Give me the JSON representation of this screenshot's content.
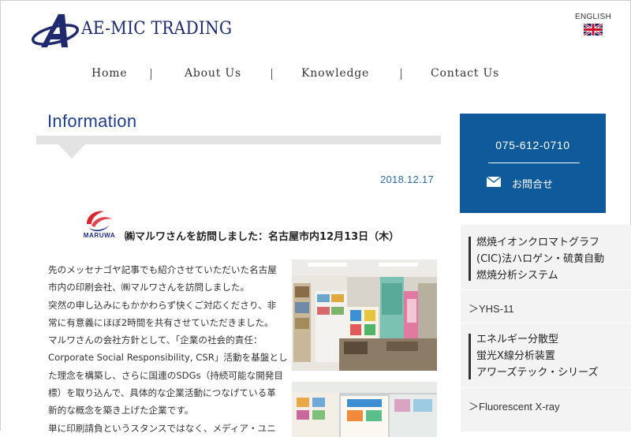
{
  "header": {
    "brand": "AE-MIC TRADING",
    "language_label": "ENGLISH"
  },
  "nav": {
    "items": [
      "Home",
      "About Us",
      "Knowledge",
      "Contact Us"
    ]
  },
  "main": {
    "section_title": "Information",
    "date": "2018.12.17",
    "company_logo_text": "MARUWA",
    "post_title": "㈱マルワさんを訪問しました：名古屋市内12月13日（木）",
    "body_lines": [
      "先のメッセナゴヤ記事でも紹介させていただいた名古屋",
      "市内の印刷会社、㈱マルワさんを訪問しました。",
      "突然の申し込みにもかかわらず快くご対応くださり、非",
      "常に有意義にほぼ2時間を共有させていただきました。",
      "マルワさんの会社方針として、「企業の社会的責任：",
      "Corporate Social Responsibility, CSR」活動を基盤とし",
      "た理念を構築し、さらに国連のSDGs（持続可能な開発目",
      "標）を取り込んで、具体的な企業活動につなげている革",
      "新的な概念を築き上げた企業です。",
      "単に印刷請負というスタンスではなく、メディア・ユニ"
    ]
  },
  "sidebar": {
    "phone": "075-612-0710",
    "contact_label": "お問合せ",
    "products": [
      {
        "title_lines": [
          "燃焼イオンクロマトグラフ",
          "(CIC)法ハロゲン・硫黄自動",
          "燃焼分析システム"
        ],
        "link": "＞YHS-11"
      },
      {
        "title_lines": [
          "エネルギー分散型",
          "蛍光X線分析装置",
          "アワーズテック・シリーズ"
        ],
        "link": "＞Fluorescent X-ray"
      }
    ]
  },
  "colors": {
    "brand_navy": "#1f2a6e",
    "info_blue": "#1f3d8a",
    "contact_blue": "#0f5a9a",
    "date_blue": "#2d6b9f"
  }
}
